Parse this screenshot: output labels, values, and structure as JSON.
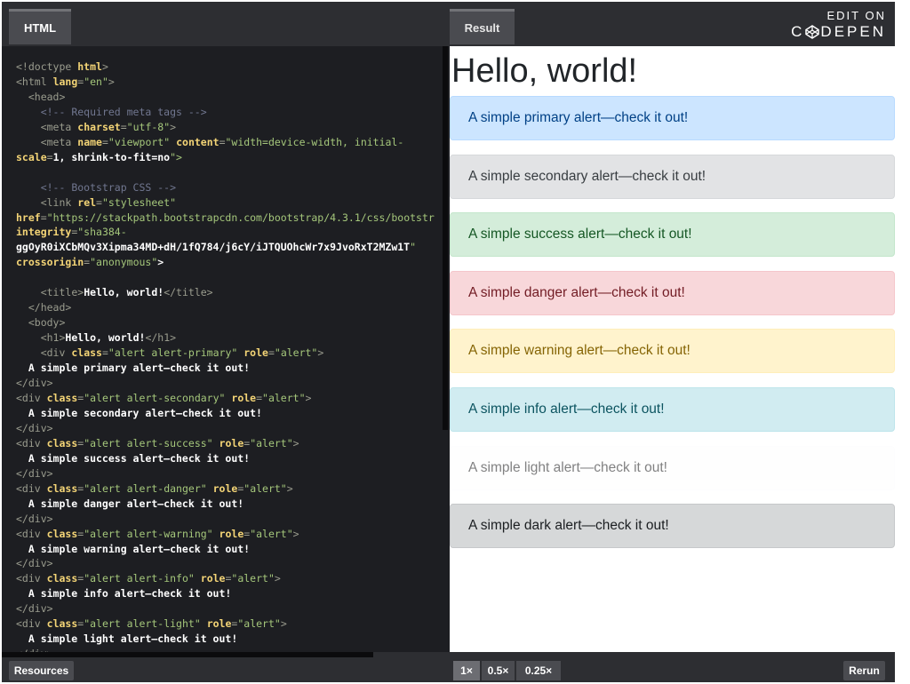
{
  "tabs": {
    "html": "HTML",
    "result": "Result"
  },
  "brand": {
    "edit_on": "EDIT ON",
    "codepen_c": "C",
    "codepen_rest": "DEPEN"
  },
  "code_lines": [
    "<!doctype html>",
    "<html lang=\"en\">",
    "  <head>",
    "    <!-- Required meta tags -->",
    "    <meta charset=\"utf-8\">",
    "    <meta name=\"viewport\" content=\"width=device-width, initial-",
    "scale=1, shrink-to-fit=no\">",
    "",
    "    <!-- Bootstrap CSS -->",
    "    <link rel=\"stylesheet\"",
    "href=\"https://stackpath.bootstrapcdn.com/bootstrap/4.3.1/css/bootstr",
    "integrity=\"sha384-",
    "ggOyR0iXCbMQv3Xipma34MD+dH/1fQ784/j6cY/iJTQUOhcWr7x9JvoRxT2MZw1T\"",
    "crossorigin=\"anonymous\">",
    "",
    "    <title>Hello, world!</title>",
    "  </head>",
    "  <body>",
    "    <h1>Hello, world!</h1>",
    "    <div class=\"alert alert-primary\" role=\"alert\">",
    "  A simple primary alert—check it out!",
    "</div>",
    "<div class=\"alert alert-secondary\" role=\"alert\">",
    "  A simple secondary alert—check it out!",
    "</div>",
    "<div class=\"alert alert-success\" role=\"alert\">",
    "  A simple success alert—check it out!",
    "</div>",
    "<div class=\"alert alert-danger\" role=\"alert\">",
    "  A simple danger alert—check it out!",
    "</div>",
    "<div class=\"alert alert-warning\" role=\"alert\">",
    "  A simple warning alert—check it out!",
    "</div>",
    "<div class=\"alert alert-info\" role=\"alert\">",
    "  A simple info alert—check it out!",
    "</div>",
    "<div class=\"alert alert-light\" role=\"alert\">",
    "  A simple light alert—check it out!",
    "</div>"
  ],
  "result": {
    "heading": "Hello, world!",
    "alerts": {
      "primary": "A simple primary alert—check it out!",
      "secondary": "A simple secondary alert—check it out!",
      "success": "A simple success alert—check it out!",
      "danger": "A simple danger alert—check it out!",
      "warning": "A simple warning alert—check it out!",
      "info": "A simple info alert—check it out!",
      "light": "A simple light alert—check it out!",
      "dark": "A simple dark alert—check it out!"
    }
  },
  "bottom": {
    "resources": "Resources",
    "zoom": [
      "1×",
      "0.5×",
      "0.25×"
    ],
    "rerun": "Rerun"
  },
  "colors": {
    "editor_bg": "#1d1e22",
    "bar_bg": "#2d2e32",
    "tag": "#9a9c8e",
    "attr": "#f3d476",
    "string": "#a5c77b",
    "comment": "#717790"
  }
}
